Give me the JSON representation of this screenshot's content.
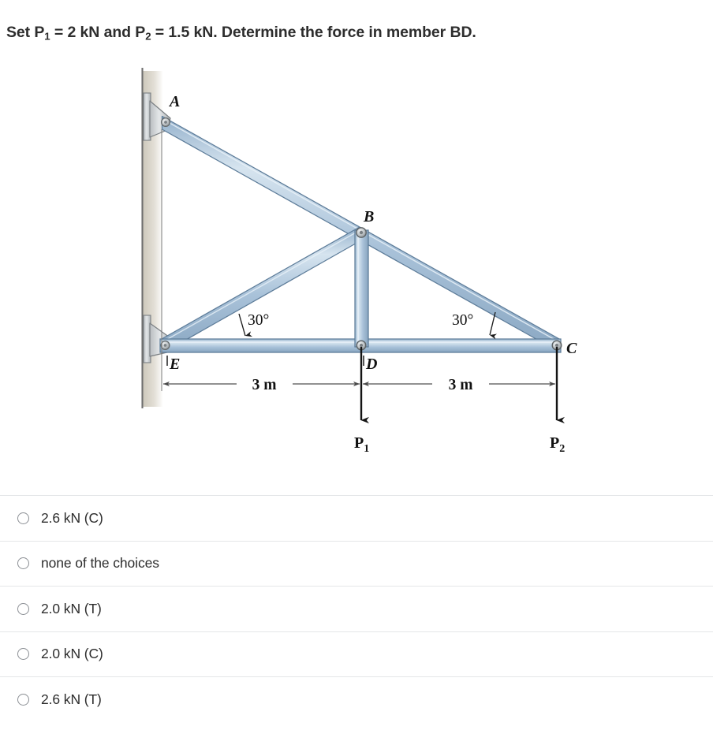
{
  "question": {
    "text_parts": {
      "lead": "Set P",
      "sub1": "1",
      "mid": " = 2 kN and P",
      "sub2": "2",
      "tail": " = 1.5 kN. Determine the force in member BD."
    },
    "plain_text": "Set P1 = 2 kN and P2 = 1.5 kN. Determine the force in member BD.",
    "given": {
      "P1": "2 kN",
      "P2": "1.5 kN",
      "member_of_interest": "BD"
    }
  },
  "figure": {
    "type": "truss-diagram",
    "joint_labels": {
      "A": "A",
      "B": "B",
      "C": "C",
      "D": "D",
      "E": "E"
    },
    "angle_labels": {
      "left": "30°",
      "right": "30°"
    },
    "dimension_labels": {
      "left_span": "3 m",
      "right_span": "3 m"
    },
    "load_labels": {
      "P1": {
        "base": "P",
        "sub": "1"
      },
      "P2": {
        "base": "P",
        "sub": "2"
      }
    },
    "colors": {
      "member_fill": "#a8c0d8",
      "member_light": "#cfdeeb",
      "member_edge": "#5f7f9c",
      "pin_fill": "#c8ccce",
      "pin_edge": "#6e7477",
      "wall_line": "#6b6b6b",
      "wall_shadow": "#ddd9cf",
      "dimension_line": "#5a5a5a",
      "load_arrow": "#1a1a1a",
      "label_text": "#111111"
    },
    "geometry_note": {
      "supports": [
        "A pinned to wall",
        "E pinned to wall"
      ],
      "members": [
        "AC",
        "EB",
        "EC",
        "BD",
        "BC"
      ],
      "loads": [
        "P1 downward at D",
        "P2 downward at C"
      ]
    }
  },
  "choices": [
    {
      "id": "choice-1",
      "label": "2.6 kN (C)",
      "selected": false
    },
    {
      "id": "choice-2",
      "label": "none of the choices",
      "selected": false
    },
    {
      "id": "choice-3",
      "label": "2.0 kN (T)",
      "selected": false
    },
    {
      "id": "choice-4",
      "label": "2.0 kN (C)",
      "selected": false
    },
    {
      "id": "choice-5",
      "label": "2.6 kN (T)",
      "selected": false
    }
  ]
}
